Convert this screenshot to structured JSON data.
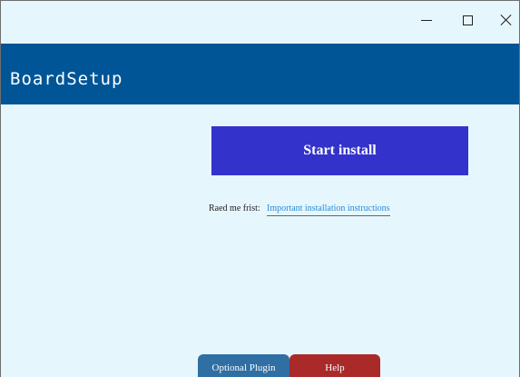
{
  "window": {
    "controls": {
      "minimize": "minimize-icon",
      "maximize": "maximize-icon",
      "close": "close-icon"
    }
  },
  "header": {
    "title": "BoardSetup"
  },
  "main": {
    "start_button": "Start install",
    "readme_prefix": "Raed me frist:",
    "readme_link": "Important installation instructions"
  },
  "tabs": [
    {
      "label": "Optional Plugin",
      "color": "#2f6fa3"
    },
    {
      "label": "Help",
      "color": "#aa2a2a"
    }
  ],
  "colors": {
    "header": "#005596",
    "background": "#e6f6fd",
    "start_button": "#3333cc",
    "link": "#2c8bd6"
  }
}
